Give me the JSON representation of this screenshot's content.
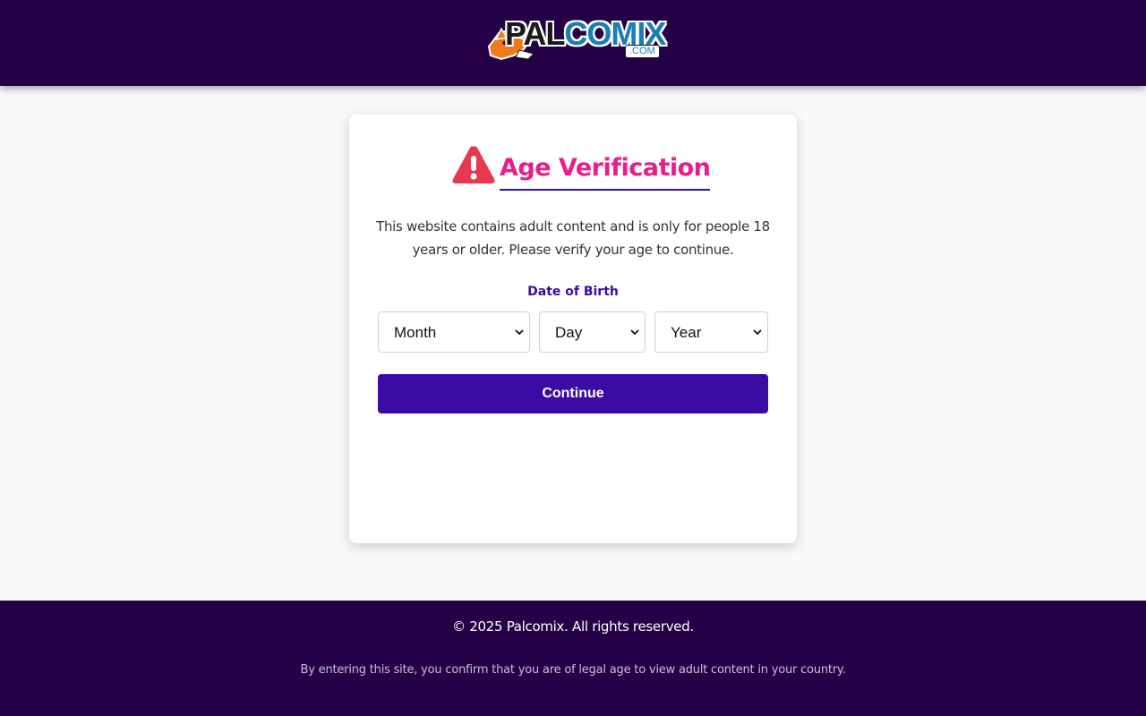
{
  "header": {
    "logo": {
      "text_pal": "PAL",
      "text_comix": "COMIX",
      "text_dotcom": ".COM"
    }
  },
  "card": {
    "title": "Age Verification",
    "description": "This website contains adult content and is only for people 18 years or older. Please verify your age to continue.",
    "dob_label": "Date of Birth",
    "selects": {
      "month": "Month",
      "day": "Day",
      "year": "Year"
    },
    "continue_label": "Continue"
  },
  "footer": {
    "copyright": "© 2025 Palcomix. All rights reserved.",
    "disclaimer": "By entering this site, you confirm that you are of legal age to view adult content in your country."
  },
  "colors": {
    "header_bg": "#240047",
    "accent_pink": "#e91e8c",
    "primary_purple": "#3a0ca3",
    "warning_red": "#e63950"
  },
  "icons": [
    "warning-triangle-icon",
    "chevron-down-icon"
  ]
}
